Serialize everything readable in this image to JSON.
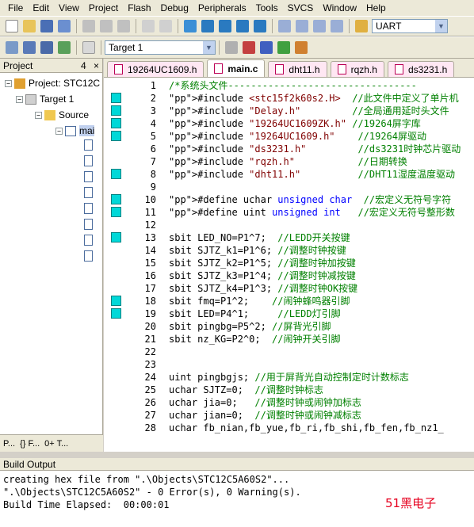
{
  "menu": [
    "File",
    "Edit",
    "View",
    "Project",
    "Flash",
    "Debug",
    "Peripherals",
    "Tools",
    "SVCS",
    "Window",
    "Help"
  ],
  "toolbar": {
    "search_value": "UART",
    "target_value": "Target 1"
  },
  "project_panel": {
    "title": "Project",
    "pin": "4",
    "close": "×",
    "root": "Project: STC12C",
    "target": "Target 1",
    "group": "Source",
    "file": "mai",
    "tabs": [
      "P...",
      "{} F...",
      "0+ T..."
    ]
  },
  "editor": {
    "tabs": [
      {
        "label": "19264UC1609.h",
        "active": false
      },
      {
        "label": "main.c",
        "active": true
      },
      {
        "label": "dht11.h",
        "active": false
      },
      {
        "label": "rqzh.h",
        "active": false
      },
      {
        "label": "ds3231.h",
        "active": false
      }
    ],
    "lines": [
      {
        "n": "1",
        "t": "/*系统头文件---------------------------------",
        "mk": false
      },
      {
        "n": "2",
        "t": "#include <stc15f2k60s2.H>  //此文件中定义了单片机",
        "mk": true
      },
      {
        "n": "3",
        "t": "#include \"Delay.h\"         //全局通用延时头文件",
        "mk": true
      },
      {
        "n": "4",
        "t": "#include \"19264UC1609ZK.h\" //19264屏字库",
        "mk": true
      },
      {
        "n": "5",
        "t": "#include \"19264UC1609.h\"    //19264屏驱动",
        "mk": true
      },
      {
        "n": "6",
        "t": "#include \"ds3231.h\"         //ds3231时钟芯片驱动",
        "mk": false
      },
      {
        "n": "7",
        "t": "#include \"rqzh.h\"           //日期转换",
        "mk": false
      },
      {
        "n": "8",
        "t": "#include \"dht11.h\"          //DHT11湿度温度驱动",
        "mk": true
      },
      {
        "n": "9",
        "t": "",
        "mk": false
      },
      {
        "n": "10",
        "t": "#define uchar unsigned char  //宏定义无符号字符",
        "mk": true
      },
      {
        "n": "11",
        "t": "#define uint unsigned int   //宏定义无符号整形数",
        "mk": true
      },
      {
        "n": "12",
        "t": "",
        "mk": false
      },
      {
        "n": "13",
        "t": "sbit LED_NO=P1^7;  //LEDD开关按键",
        "mk": true
      },
      {
        "n": "14",
        "t": "sbit SJTZ_k1=P1^6; //调整时钟按键",
        "mk": false
      },
      {
        "n": "15",
        "t": "sbit SJTZ_k2=P1^5; //调整时钟加按键",
        "mk": false
      },
      {
        "n": "16",
        "t": "sbit SJTZ_k3=P1^4; //调整时钟减按键",
        "mk": false
      },
      {
        "n": "17",
        "t": "sbit SJTZ_k4=P1^3; //调整时钟OK按键",
        "mk": false
      },
      {
        "n": "18",
        "t": "sbit fmq=P1^2;    //闹钟蜂鸣器引脚",
        "mk": true
      },
      {
        "n": "19",
        "t": "sbit LED=P4^1;     //LEDD灯引脚",
        "mk": true
      },
      {
        "n": "20",
        "t": "sbit pingbg=P5^2; //屏背光引脚",
        "mk": false
      },
      {
        "n": "21",
        "t": "sbit nz_KG=P2^0;  //闹钟开关引脚",
        "mk": false
      },
      {
        "n": "22",
        "t": "",
        "mk": false
      },
      {
        "n": "23",
        "t": "",
        "mk": false
      },
      {
        "n": "24",
        "t": "uint pingbgjs; //用于屏背光自动控制定时计数标志",
        "mk": false
      },
      {
        "n": "25",
        "t": "uchar SJTZ=0;  //调整时钟标志",
        "mk": false
      },
      {
        "n": "26",
        "t": "uchar jia=0;   //调整时钟或闹钟加标志",
        "mk": false
      },
      {
        "n": "27",
        "t": "uchar jian=0;  //调整时钟或闹钟减标志",
        "mk": false
      },
      {
        "n": "28",
        "t": "uchar fb_nian,fb_yue,fb_ri,fb_shi,fb_fen,fb_nz1_",
        "mk": false
      }
    ]
  },
  "build": {
    "title": "Build Output",
    "lines": [
      "creating hex file from \".\\Objects\\STC12C5A60S2\"...",
      "\".\\Objects\\STC12C5A60S2\" - 0 Error(s), 0 Warning(s).",
      "Build Time Elapsed:  00:00:01"
    ]
  },
  "watermark": "51黑电子",
  "colors": {
    "marker": "#00d8d8",
    "tab_pink": "#ffe7f3",
    "watermark": "#e6001f"
  }
}
